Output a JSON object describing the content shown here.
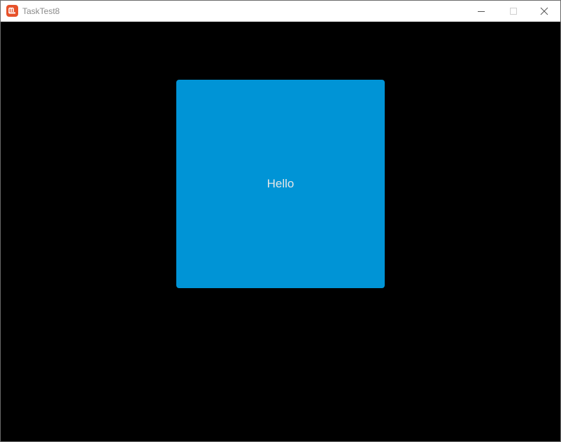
{
  "window": {
    "title": "TaskTest8",
    "app_icon": "monogame-logo-icon",
    "controls": {
      "minimize_icon": "minimize-icon",
      "maximize_icon": "maximize-icon",
      "close_icon": "close-icon"
    }
  },
  "content": {
    "background": "#000000",
    "panel": {
      "label": "Hello",
      "color": "#0094D6"
    }
  },
  "colors": {
    "accent": "#E7522B",
    "title_text": "#8a8a8a"
  }
}
